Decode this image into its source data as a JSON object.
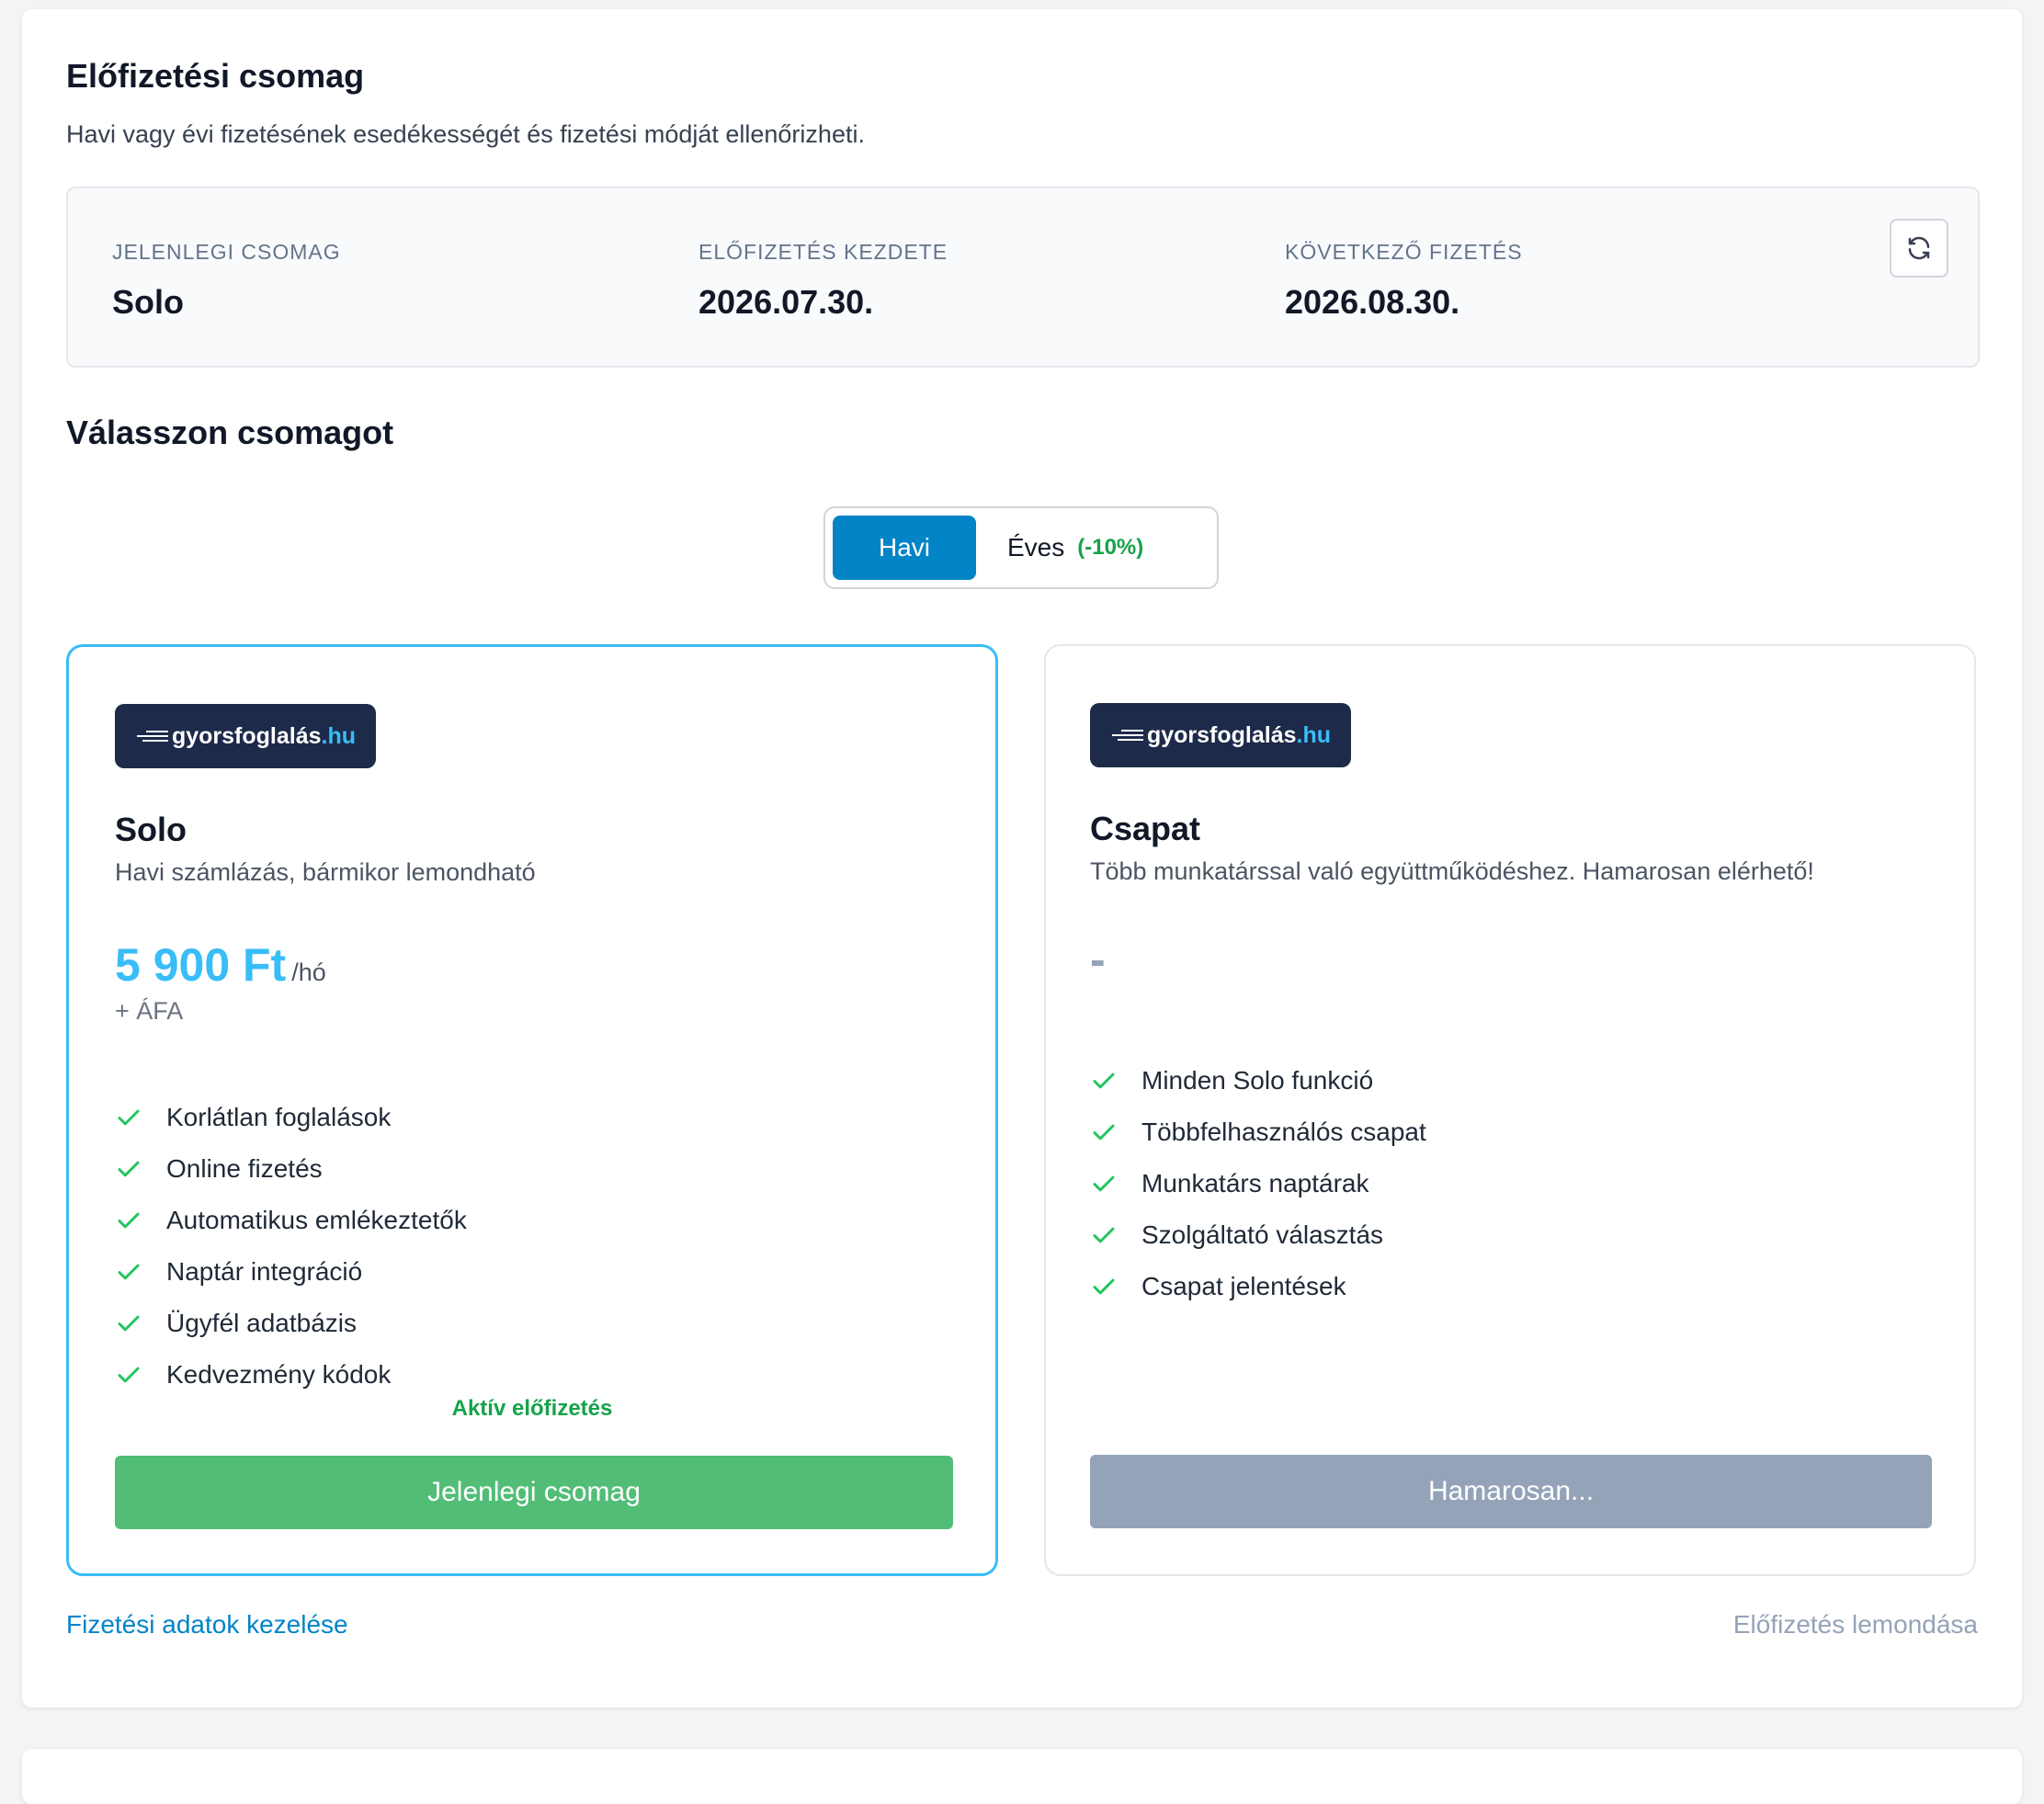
{
  "header": {
    "title": "Előfizetési csomag",
    "subtitle": "Havi vagy évi fizetésének esedékességét és fizetési módját ellenőrizheti."
  },
  "current_info": {
    "plan_label": "JELENLEGI CSOMAG",
    "plan_value": "Solo",
    "start_label": "ELŐFIZETÉS KEZDETE",
    "start_value": "2026.07.30.",
    "next_label": "KÖVETKEZŐ FIZETÉS",
    "next_value": "2026.08.30."
  },
  "choose_title": "Válasszon csomagot",
  "billing_toggle": {
    "monthly": "Havi",
    "yearly": "Éves",
    "yearly_discount": "(-10%)",
    "selected": "monthly"
  },
  "logo": {
    "name": "gyorsfoglalás",
    "tld": ".hu"
  },
  "plans": [
    {
      "name": "Solo",
      "description": "Havi számlázás, bármikor lemondható",
      "price": "5 900 Ft",
      "period": "/hó",
      "vat": "+ ÁFA",
      "features": [
        "Korlátlan foglalások",
        "Online fizetés",
        "Automatikus emlékeztetők",
        "Naptár integráció",
        "Ügyfél adatbázis",
        "Kedvezmény kódok"
      ],
      "status": "Aktív előfizetés",
      "button": "Jelenlegi csomag"
    },
    {
      "name": "Csapat",
      "description": "Több munkatárssal való együttműködéshez. Hamarosan elérhető!",
      "price": "-",
      "features": [
        "Minden Solo funkció",
        "Többfelhasználós csapat",
        "Munkatárs naptárak",
        "Szolgáltató választás",
        "Csapat jelentések"
      ],
      "button": "Hamarosan..."
    }
  ],
  "footer": {
    "manage_payment": "Fizetési adatok kezelése",
    "cancel_subscription": "Előfizetés lemondása"
  },
  "colors": {
    "primary": "#0284c7",
    "accent": "#38bdf8",
    "success": "#16a34a",
    "current_button": "#52bd77",
    "disabled_button": "#94a3b8",
    "logo_bg": "#1e2a4a"
  }
}
